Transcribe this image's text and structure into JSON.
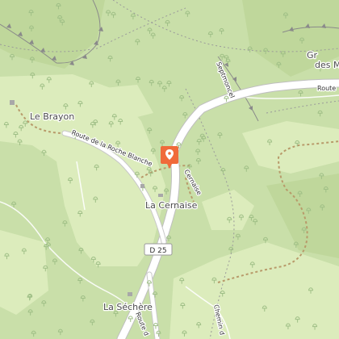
{
  "places": {
    "le_brayon": "Le Brayon",
    "la_cernaise": "La Cernaise",
    "la_sechere": "La Séchère",
    "cernaise_small": "Cernaise",
    "gr_top": "Gr",
    "des_m": "des M"
  },
  "roads": {
    "route_roche_blanche": "Route de la Roche Blanche",
    "septmoncel": "Septmoncel",
    "route_right": "Route",
    "route_bottom": "Route d",
    "chemin": "Chemin d"
  },
  "shield": {
    "d25": "D 25"
  },
  "icons": {
    "marker": "map-pin-icon",
    "trees": "tree-icon"
  },
  "colors": {
    "forest": "#c9dfa9",
    "meadow": "#dcecbc",
    "road": "#ffffff",
    "road_casing": "#bfbfbf",
    "trail": "#b89a6a",
    "marker": "#f06a3a"
  }
}
